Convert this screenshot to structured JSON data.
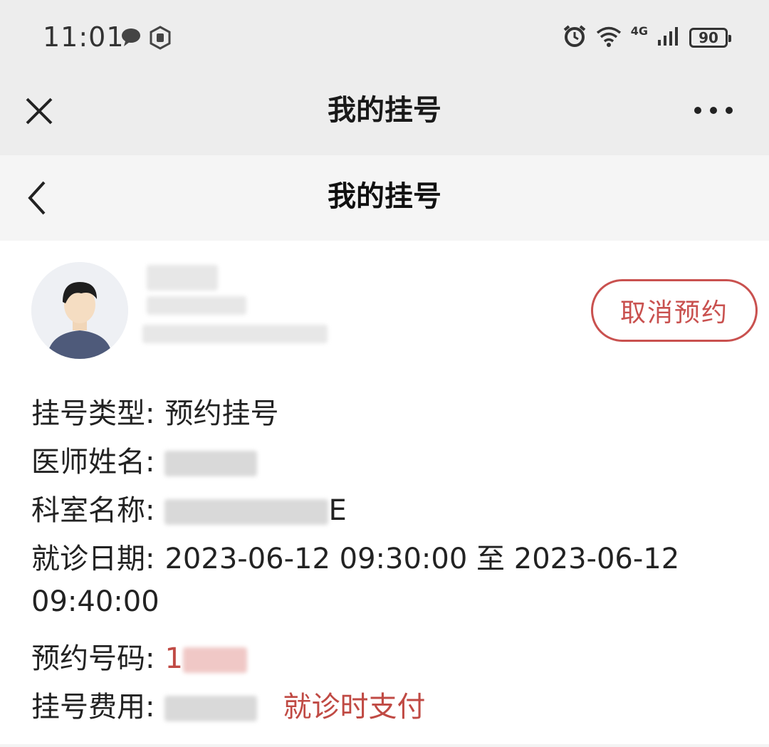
{
  "status_bar": {
    "time": "11:01",
    "battery": "90",
    "network": "4G",
    "icons": [
      "chat-bubble-icon",
      "shield-icon",
      "alarm-icon",
      "wifi-icon",
      "signal-icon",
      "battery-icon"
    ]
  },
  "wechat_nav": {
    "title": "我的挂号",
    "close_icon": "close-icon",
    "more_icon": "more-icon"
  },
  "page_nav": {
    "title": "我的挂号",
    "back_icon": "back-icon"
  },
  "patient": {
    "avatar_icon": "avatar-icon",
    "cancel_label": "取消预约"
  },
  "details": {
    "type_label": "挂号类型:",
    "type_value": "预约挂号",
    "doctor_label": "医师姓名:",
    "department_label": "科室名称:",
    "department_visible_suffix": "E",
    "date_label": "就诊日期:",
    "date_value_line1": "2023-06-12 09:30:00 至 2023-06-12",
    "date_value_line2": "09:40:00",
    "number_label": "预约号码:",
    "number_value_prefix": "1",
    "fee_label": "挂号费用:",
    "fee_note": "就诊时支付"
  },
  "colors": {
    "accent": "#c9514f",
    "nav_bg": "#ededed",
    "page_nav_bg": "#f5f5f5"
  }
}
